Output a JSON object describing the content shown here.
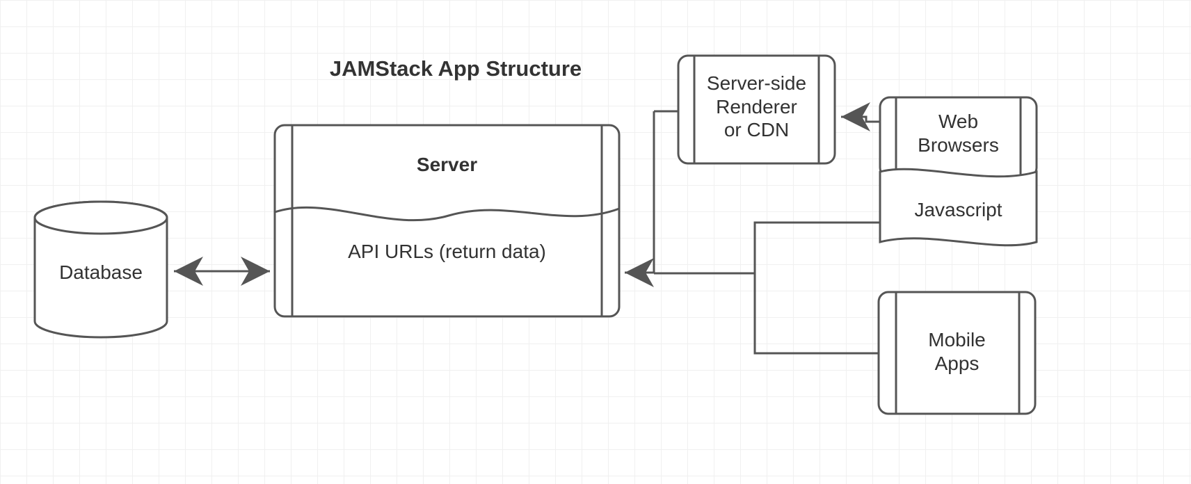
{
  "title": "JAMStack App Structure",
  "nodes": {
    "database": "Database",
    "server": "Server",
    "api": "API URLs (return data)",
    "renderer": "Server-side Renderer\nor CDN",
    "web": "Web\nBrowsers",
    "js": "Javascript",
    "mobile": "Mobile\nApps"
  },
  "colors": {
    "stroke": "#555555",
    "strokeLight": "#666666",
    "bg": "#ffffff"
  }
}
